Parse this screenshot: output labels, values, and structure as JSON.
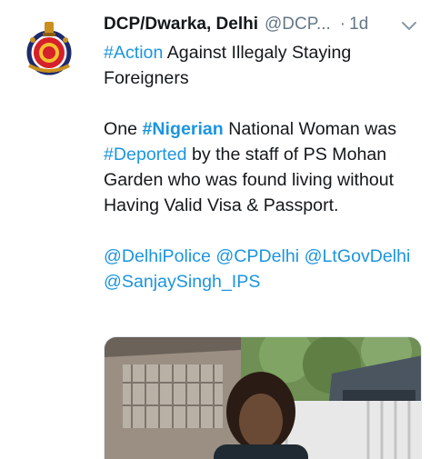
{
  "tweet": {
    "display_name": "DCP/Dwarka, Delhi",
    "handle": "@DCP...",
    "dot": "·",
    "time": "1d",
    "line1_tag": "#Action",
    "line1_rest": " Against Illegaly Staying Foreigners",
    "p2_a": "One ",
    "p2_tag_nigerian": "#Nigerian",
    "p2_b": " National Woman was ",
    "p2_tag_deported": "#Deported",
    "p2_c": " by the staff of PS Mohan Garden who was found living without Having Valid Visa & Passport.",
    "mention1": "@DelhiPolice",
    "mention2": "@CPDelhi",
    "mention3": "@LtGovDelhi",
    "mention4": "@SanjaySingh_IPS"
  },
  "colors": {
    "link": "#1b95e0",
    "text": "#14171a",
    "muted": "#657786"
  },
  "icons": {
    "avatar": "delhi-police-emblem-icon",
    "caret": "chevron-down-icon"
  }
}
